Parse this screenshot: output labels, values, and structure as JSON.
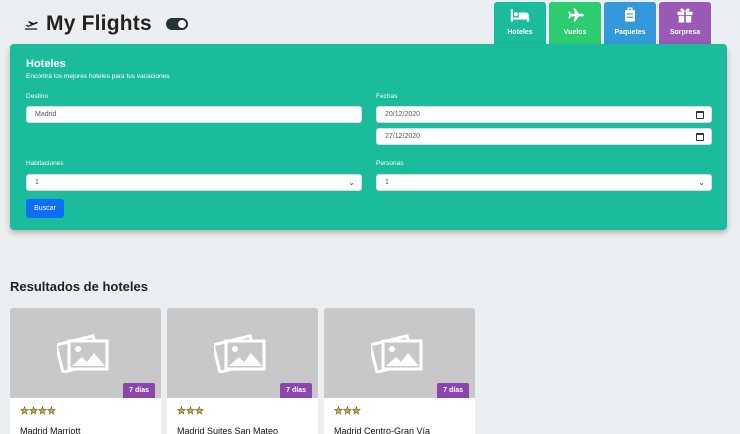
{
  "app": {
    "title": "My Flights"
  },
  "tabs": [
    {
      "label": "Hoteles",
      "icon": "bed-icon",
      "color": "#1abc9c"
    },
    {
      "label": "Vuelos",
      "icon": "airplane-icon",
      "color": "#2ecc71"
    },
    {
      "label": "Paquetes",
      "icon": "luggage-icon",
      "color": "#3498db"
    },
    {
      "label": "Sorpresa",
      "icon": "gift-icon",
      "color": "#9b59b6"
    }
  ],
  "search": {
    "title": "Hoteles",
    "subtitle": "Encontrá los mejores hoteles para tus vacaciones",
    "destino_label": "Destino",
    "destino_value": "Madrid",
    "fechas_label": "Fechas",
    "fecha_desde": "20/12/2020",
    "fecha_hasta": "27/12/2020",
    "habitaciones_label": "Habitaciones",
    "habitaciones_value": "1",
    "personas_label": "Personas",
    "personas_value": "1",
    "buscar_label": "Buscar"
  },
  "results": {
    "title": "Resultados de hoteles",
    "hotels": [
      {
        "name": "Madrid Marriott",
        "stars": "★★★★",
        "star_count": 4,
        "badge": "7 días"
      },
      {
        "name": "Madrid Suites San Mateo",
        "stars": "★★★",
        "star_count": 3,
        "badge": "7 días"
      },
      {
        "name": "Madrid Centro-Gran Vía",
        "stars": "★★★",
        "star_count": 3,
        "badge": "7 días"
      }
    ]
  },
  "colors": {
    "panel": "#1abc9c",
    "badge": "#8e44ad",
    "buscar": "#0d6efd"
  }
}
